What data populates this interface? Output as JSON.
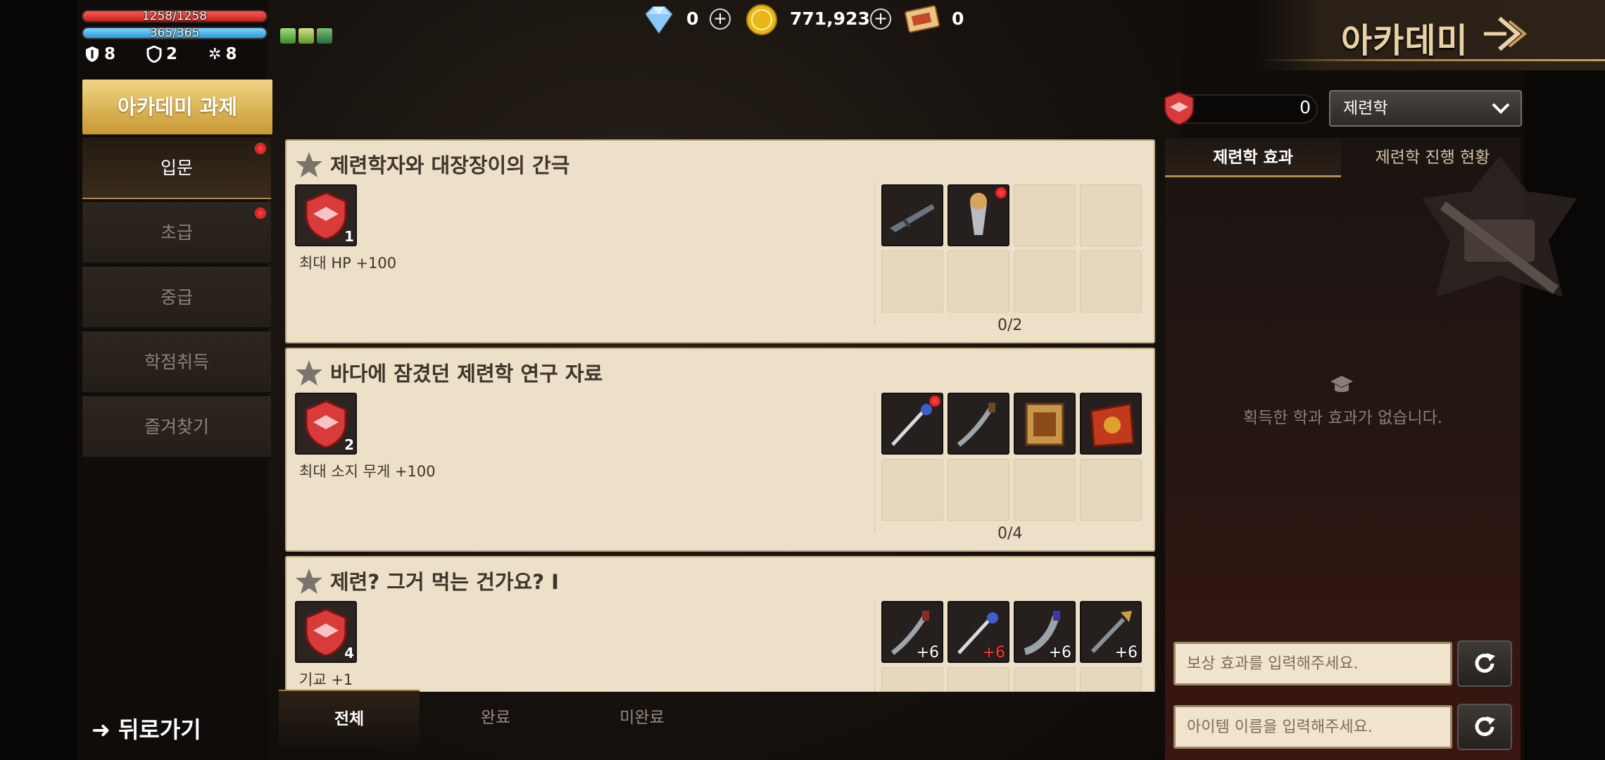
{
  "status": {
    "hp": "1258/1258",
    "hp_fraction": 1.0,
    "mp": "365/365",
    "mp_fraction": 1.0,
    "stats": [
      "8",
      "2",
      "8"
    ],
    "stat_icons": [
      "defense-shield-icon",
      "guard-icon",
      "star-gear-icon"
    ],
    "buff_icons": [
      "buff-1-icon",
      "buff-2-icon",
      "buff-3-icon"
    ]
  },
  "currency": {
    "diamond": "0",
    "gold": "771,923",
    "ticket": "0"
  },
  "title": "아카데미",
  "nav": {
    "header": "아카데미 과제",
    "items": [
      {
        "label": "입문",
        "active": true,
        "dot": true
      },
      {
        "label": "초급",
        "active": false,
        "dot": true
      },
      {
        "label": "중급",
        "active": false,
        "dot": false
      },
      {
        "label": "학점취득",
        "active": false,
        "dot": false
      },
      {
        "label": "즐겨찾기",
        "active": false,
        "dot": false
      }
    ],
    "back": "뒤로가기"
  },
  "filter": {
    "coin_count": "0",
    "category": "제련학"
  },
  "quests": [
    {
      "title": "제련학자와 대장장이의 간극",
      "badge_count": "1",
      "desc": "최대 HP +100",
      "progress": "0/2",
      "slots": [
        {
          "filled": true,
          "item": "rifle-item",
          "level": "",
          "dot": false
        },
        {
          "filled": true,
          "item": "drill-item",
          "level": "",
          "dot": true
        },
        {
          "filled": false
        },
        {
          "filled": false
        },
        {
          "filled": false
        },
        {
          "filled": false
        },
        {
          "filled": false
        },
        {
          "filled": false
        }
      ]
    },
    {
      "title": "바다에 잠겼던 제련학 연구 자료",
      "badge_count": "2",
      "desc": "최대 소지 무게 +100",
      "progress": "0/4",
      "slots": [
        {
          "filled": true,
          "item": "rapier-item",
          "level": "",
          "dot": true
        },
        {
          "filled": true,
          "item": "dagger-item",
          "level": "",
          "dot": false
        },
        {
          "filled": true,
          "item": "scroll-item",
          "level": "",
          "dot": false
        },
        {
          "filled": true,
          "item": "pouch-item",
          "level": "",
          "dot": false
        },
        {
          "filled": false
        },
        {
          "filled": false
        },
        {
          "filled": false
        },
        {
          "filled": false
        }
      ]
    },
    {
      "title": "제련? 그거 먹는 건가요? Ⅰ",
      "badge_count": "4",
      "desc": "기교 +1",
      "progress": "",
      "slots": [
        {
          "filled": true,
          "item": "dagger-item",
          "level": "+6",
          "dot": false,
          "red": false
        },
        {
          "filled": true,
          "item": "rapier-item",
          "level": "+6",
          "dot": false,
          "red": true
        },
        {
          "filled": true,
          "item": "kukri-item",
          "level": "+6",
          "dot": false,
          "red": false
        },
        {
          "filled": true,
          "item": "spear-item",
          "level": "+6",
          "dot": false,
          "red": false
        },
        {
          "filled": false
        },
        {
          "filled": false
        },
        {
          "filled": false
        },
        {
          "filled": false
        }
      ]
    }
  ],
  "bottom_tabs": [
    {
      "label": "전체",
      "active": true
    },
    {
      "label": "완료",
      "active": false
    },
    {
      "label": "미완료",
      "active": false
    }
  ],
  "right": {
    "tabs": [
      {
        "label": "제련학 효과",
        "active": true
      },
      {
        "label": "제련학 진행 현황",
        "active": false
      }
    ],
    "empty": "획득한 학과 효과가 없습니다.",
    "reward_placeholder": "보상 효과를 입력해주세요.",
    "item_placeholder": "아이템 이름을 입력해주세요."
  },
  "colors": {
    "accent_gold": "#c79832",
    "card_bg": "#ede0c8",
    "hp": "#e0322b",
    "mp": "#3aa7e2",
    "badge_red": "#d93a3a"
  }
}
